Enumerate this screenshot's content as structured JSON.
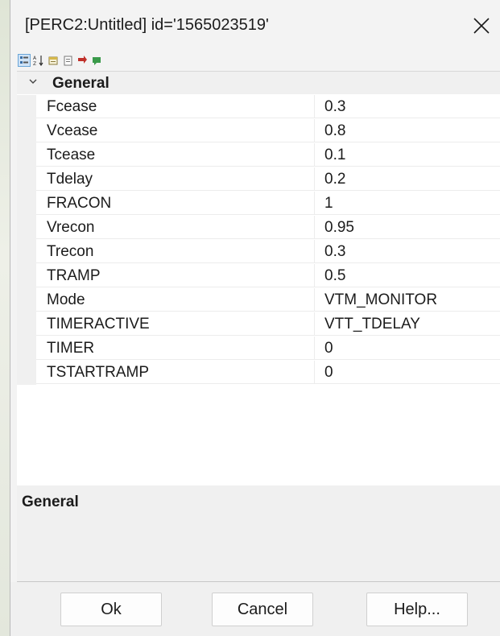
{
  "window": {
    "title": "[PERC2:Untitled] id='1565023519'"
  },
  "toolbar": {
    "buttons": [
      {
        "icon": "categorized-icon",
        "active": true
      },
      {
        "icon": "alphabetical-sort-icon",
        "active": false
      },
      {
        "icon": "property-pages-icon",
        "active": false
      },
      {
        "icon": "properties-icon",
        "active": false
      },
      {
        "icon": "events-red-icon",
        "active": false
      },
      {
        "icon": "events-green-icon",
        "active": false
      }
    ]
  },
  "grid": {
    "category": "General",
    "properties": [
      {
        "name": "Fcease",
        "value": "0.3"
      },
      {
        "name": "Vcease",
        "value": "0.8"
      },
      {
        "name": "Tcease",
        "value": "0.1"
      },
      {
        "name": "Tdelay",
        "value": "0.2"
      },
      {
        "name": "FRACON",
        "value": "1"
      },
      {
        "name": "Vrecon",
        "value": "0.95"
      },
      {
        "name": "Trecon",
        "value": "0.3"
      },
      {
        "name": "TRAMP",
        "value": "0.5"
      },
      {
        "name": "Mode",
        "value": "VTM_MONITOR"
      },
      {
        "name": "TIMERACTIVE",
        "value": "VTT_TDELAY"
      },
      {
        "name": "TIMER",
        "value": "0"
      },
      {
        "name": "TSTARTRAMP",
        "value": "0"
      }
    ]
  },
  "description": {
    "title": "General"
  },
  "buttons": {
    "ok": "Ok",
    "cancel": "Cancel",
    "help": "Help..."
  },
  "colors": {
    "window_bg": "#f3f3f3",
    "grid_bg": "#ffffff",
    "category_bg": "#f0f0f0"
  }
}
